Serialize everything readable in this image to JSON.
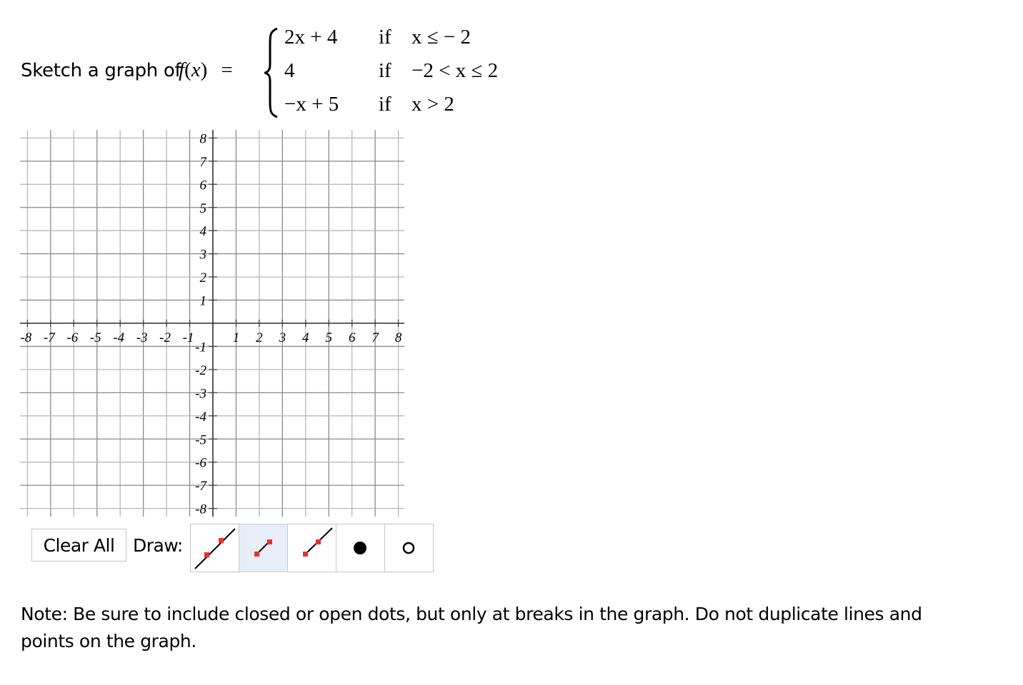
{
  "prompt": {
    "lead_text": "Sketch a graph of",
    "function_name": "f",
    "function_var": "x",
    "equals": "=",
    "cases": [
      {
        "expression": "2x + 4",
        "if_label": "if",
        "condition": "x ≤  − 2"
      },
      {
        "expression": "4",
        "if_label": "if",
        "condition": "−2 < x ≤ 2"
      },
      {
        "expression": "−x + 5",
        "if_label": "if",
        "condition": "x > 2"
      }
    ]
  },
  "graph": {
    "x_range": [
      -8,
      8
    ],
    "y_range": [
      -8,
      8
    ],
    "x_tick_labels": [
      "-8",
      "-7",
      "-6",
      "-5",
      "-4",
      "-3",
      "-2",
      "-1",
      "1",
      "2",
      "3",
      "4",
      "5",
      "6",
      "7",
      "8"
    ],
    "y_tick_labels": [
      "8",
      "7",
      "6",
      "5",
      "4",
      "3",
      "2",
      "1",
      "-1",
      "-2",
      "-3",
      "-4",
      "-5",
      "-6",
      "-7",
      "-8"
    ],
    "plotted_objects": []
  },
  "toolbar": {
    "clear_label": "Clear All",
    "draw_label": "Draw:",
    "tools": [
      {
        "name": "line",
        "icon": "line-icon",
        "selected": false
      },
      {
        "name": "segment",
        "icon": "segment-icon",
        "selected": true
      },
      {
        "name": "ray",
        "icon": "ray-icon",
        "selected": false
      },
      {
        "name": "closed-dot",
        "icon": "closed-dot-icon",
        "selected": false
      },
      {
        "name": "open-dot",
        "icon": "open-dot-icon",
        "selected": false
      }
    ],
    "colors": {
      "selected_bg": "#e7eef8",
      "point_red": "#e8332a",
      "border": "#c8c8c8"
    }
  },
  "note": "Note: Be sure to include closed or open dots, but only at breaks in the graph. Do not duplicate lines and points on the graph."
}
